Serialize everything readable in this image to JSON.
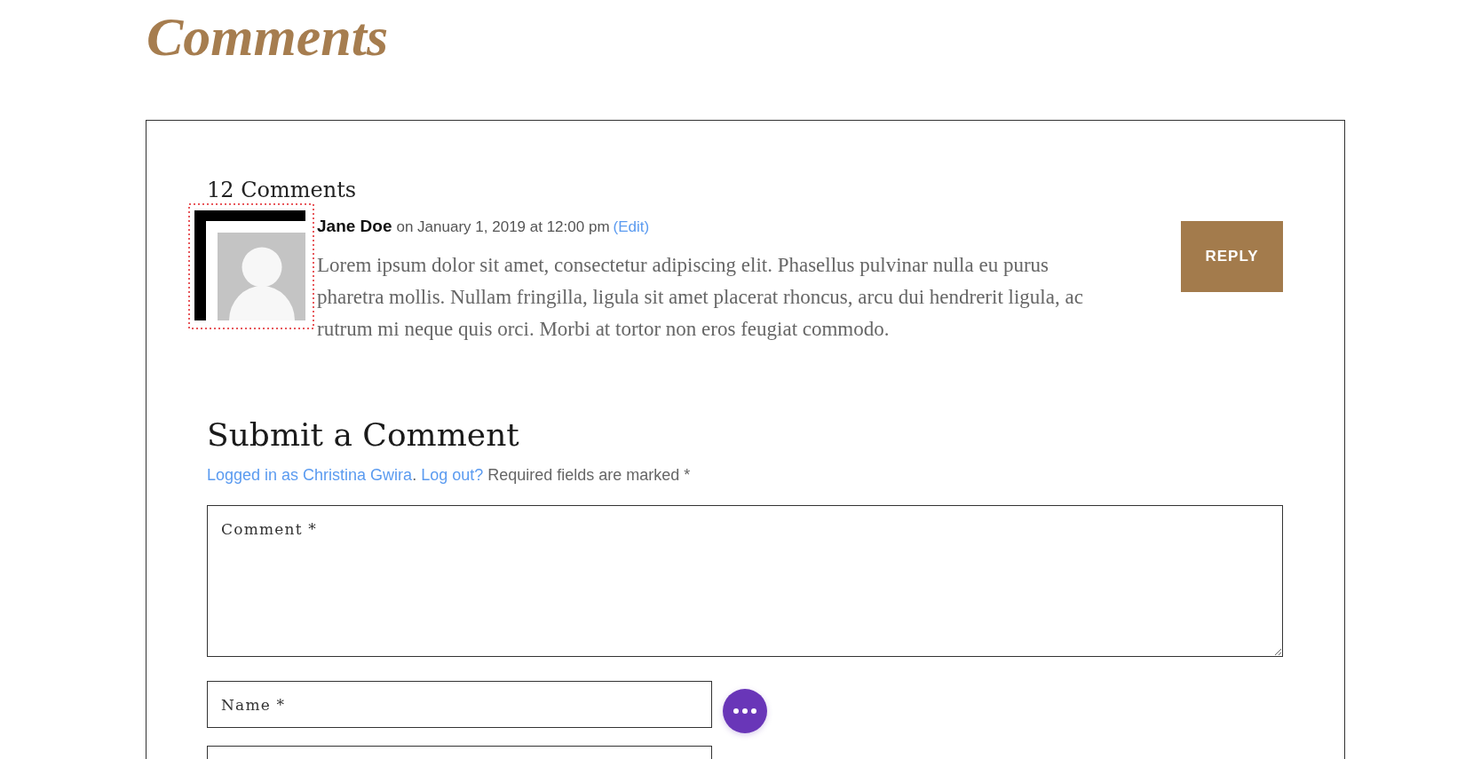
{
  "page_title": "Comments",
  "comments": {
    "count": "12 Comments",
    "items": [
      {
        "author": "Jane Doe",
        "date": "on January 1, 2019 at 12:00 pm",
        "edit_link": "(Edit)",
        "text": "Lorem ipsum dolor sit amet, consectetur adipiscing elit. Phasellus pulvinar nulla eu purus pharetra mollis. Nullam fringilla, ligula sit amet placerat rhoncus, arcu dui hendrerit ligula, ac rutrum mi neque quis orci. Morbi at tortor non eros feugiat commodo.",
        "reply_button": "REPLY"
      }
    ]
  },
  "form": {
    "heading": "Submit a Comment",
    "notice": {
      "user_link": "Logged in as Christina Gwira",
      "separator": ".",
      "logout_link": "Log out?",
      "text": "Required fields are marked *"
    },
    "fields": [
      {
        "kind": "textarea",
        "placeholder": "Comment *",
        "assist_button": false
      },
      {
        "kind": "input",
        "placeholder": "Name *",
        "assist_button": true
      },
      {
        "kind": "input",
        "assist_button": false
      }
    ]
  }
}
